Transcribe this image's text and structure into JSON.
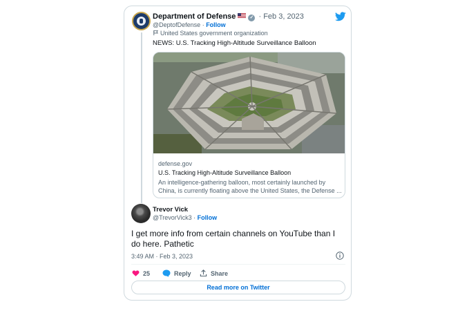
{
  "tweet": {
    "author_name": "Department of Defense",
    "author_handle": "@DeptofDefense",
    "follow_label": "Follow",
    "date": "Feb 3, 2023",
    "org_label": "United States government organization",
    "text": "NEWS: U.S. Tracking High-Altitude Surveillance Balloon",
    "link_card": {
      "domain": "defense.gov",
      "title": "U.S. Tracking High-Altitude Surveillance Balloon",
      "description": "An intelligence-gathering balloon, most certainly launched by China, is currently floating above the United States, the Defense ..."
    }
  },
  "reply": {
    "author_name": "Trevor Vick",
    "author_handle": "@TrevorVick3",
    "follow_label": "Follow",
    "text": "I get more info from certain channels on YouTube than I do here. Pathetic",
    "timestamp": "3:49 AM · Feb 3, 2023",
    "likes": "25",
    "reply_label": "Reply",
    "share_label": "Share",
    "read_more_label": "Read more on Twitter"
  },
  "colors": {
    "accent": "#1d9bf0",
    "link": "#006fd6",
    "like": "#f91880",
    "muted": "#536471",
    "border": "#cfd9de"
  },
  "icons": [
    "twitter-bird-icon",
    "verified-icon",
    "us-flag-icon",
    "government-flag-icon",
    "info-icon",
    "heart-icon",
    "reply-bubble-icon",
    "share-icon"
  ]
}
